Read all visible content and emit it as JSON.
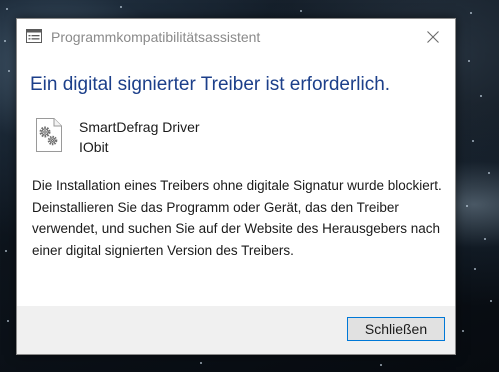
{
  "window": {
    "title": "Programmkompatibilitätsassistent",
    "title_icon": "app-window-icon",
    "close_icon": "close-icon"
  },
  "dialog": {
    "heading": "Ein digital signierter Treiber ist erforderlich.",
    "driver_icon": "driver-gears-icon",
    "driver_name": "SmartDefrag Driver",
    "driver_vendor": "IObit",
    "message": "Die Installation eines Treibers ohne digitale Signatur wurde blockiert. Deinstallieren Sie das Programm oder Gerät, das den Treiber verwendet, und suchen Sie auf der Website des Herausgebers nach einer digital signierten Version des Treibers.",
    "close_button_label": "Schließen"
  },
  "colors": {
    "heading": "#1c3f8a",
    "title_text": "#8a8a8a",
    "footer_bg": "#f0f0f0",
    "button_border": "#0078d7"
  }
}
